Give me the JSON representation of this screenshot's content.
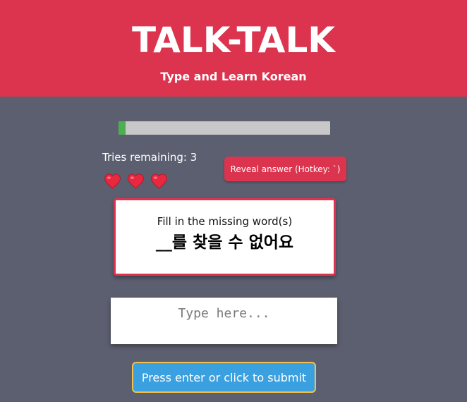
{
  "header": {
    "title": "TALK-TALK",
    "subtitle": "Type and Learn Korean"
  },
  "progress": {
    "fraction": 0.033
  },
  "status": {
    "tries_text": "Tries remaining: 3",
    "hearts": [
      "heart-icon",
      "heart-icon",
      "heart-icon"
    ]
  },
  "reveal": {
    "label": "Reveal answer (Hotkey: `)"
  },
  "question": {
    "prompt": "Fill in the missing word(s)",
    "sentence": "__를 찾을 수 없어요"
  },
  "answer": {
    "value": "",
    "placeholder": "Type here..."
  },
  "submit": {
    "label": "Press enter or click to submit"
  },
  "colors": {
    "accent": "#dc344f",
    "background": "#5c5f70",
    "progress": "#4cb050",
    "submit": "#3aa0e0",
    "submit_border": "#f2c14e"
  }
}
